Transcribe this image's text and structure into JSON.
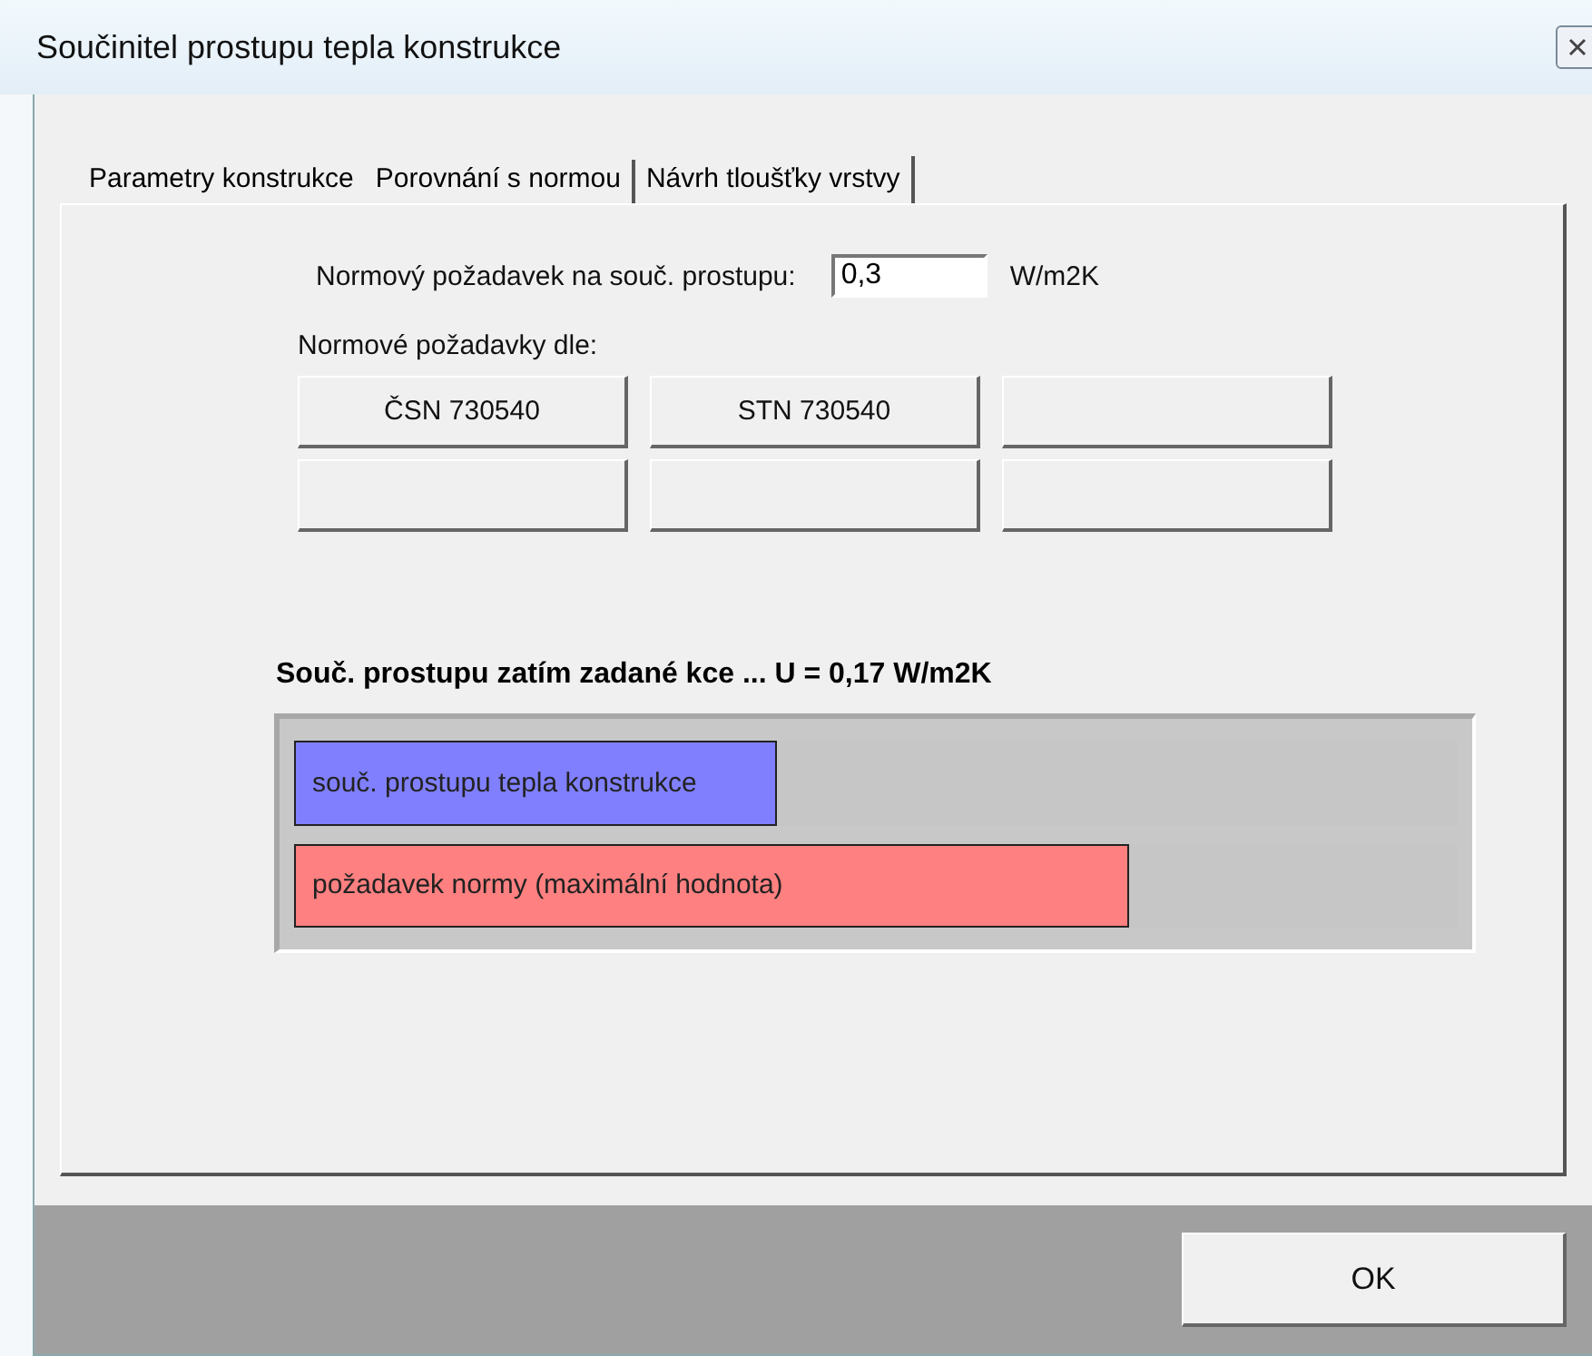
{
  "window": {
    "title": "Součinitel prostupu tepla konstrukce"
  },
  "tabs": [
    {
      "label": "Parametry konstrukce",
      "selected": false
    },
    {
      "label": "Porovnání s normou",
      "selected": true
    },
    {
      "label": "Návrh tloušťky vrstvy",
      "selected": false
    }
  ],
  "requirement": {
    "label": "Normový požadavek na souč. prostupu:",
    "value": "0,3",
    "unit": "W/m2K"
  },
  "standards": {
    "label": "Normové požadavky dle:",
    "buttons": [
      {
        "kind": "labeled",
        "label": "ČSN 730540"
      },
      {
        "kind": "labeled",
        "label": "STN 730540"
      },
      {
        "kind": "blank"
      },
      {
        "kind": "blank"
      },
      {
        "kind": "blank"
      },
      {
        "kind": "blank"
      }
    ]
  },
  "result": {
    "text": "Souč. prostupu zatím zadané kce ... U = 0,17 W/m2K"
  },
  "bars": [
    {
      "label": "souč. prostupu tepla konstrukce",
      "level": 0.415,
      "color": "#8080ff"
    },
    {
      "label": "požadavek normy (maximální hodnota)",
      "level": 0.717,
      "color": "#ff8080"
    }
  ],
  "buttons": [
    "OK"
  ]
}
